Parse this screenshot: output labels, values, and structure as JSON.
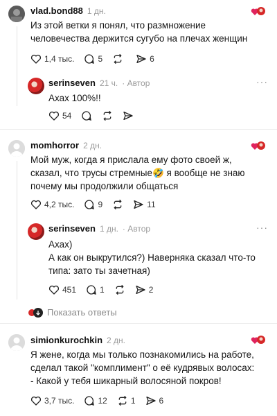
{
  "comments": [
    {
      "username": "vlad.bond88",
      "time": "1 дн.",
      "lines": [
        "Из этой ветки я понял, что размножение",
        "человечества держится сугубо на плечах женщин"
      ],
      "likes": "1,4 тыс.",
      "replies": "5",
      "reposts": "",
      "shares": "6"
    },
    {
      "username": "serinseven",
      "time": "21 ч.",
      "author_label": "Автор",
      "lines": [
        "Ахах 100%!!"
      ],
      "likes": "54",
      "replies": "",
      "reposts": "",
      "shares": ""
    },
    {
      "username": "momhorror",
      "time": "2 дн.",
      "lines": [
        "Мой муж, когда я прислала ему фото своей ж,",
        "сказал, что трусы стремные🤣 я вообще не знаю",
        "почему мы продолжили общаться"
      ],
      "likes": "4,2 тыс.",
      "replies": "9",
      "reposts": "",
      "shares": "11"
    },
    {
      "username": "serinseven",
      "time": "1 дн.",
      "author_label": "Автор",
      "lines": [
        "Ахах)",
        "А как он выкрутился?) Наверняка сказал что-то",
        "типа: зато ты зачетная)"
      ],
      "likes": "451",
      "replies": "1",
      "reposts": "",
      "shares": "2"
    },
    {
      "username": "simionkurochkin",
      "time": "2 дн.",
      "lines": [
        "Я жене, когда мы только познакомились на работе,",
        "сделал такой \"комплимент\" о её кудрявых волосах:",
        "- Какой у тебя шикарный волосяной покров!"
      ],
      "likes": "3,7 тыс.",
      "replies": "12",
      "reposts": "1",
      "shares": "6"
    }
  ],
  "show_replies_label": "Показать ответы",
  "more_label": "···",
  "colors": {
    "liked_heart": "#e0245e",
    "author_avatar": "#d62828",
    "muted": "#9a9a9a"
  }
}
